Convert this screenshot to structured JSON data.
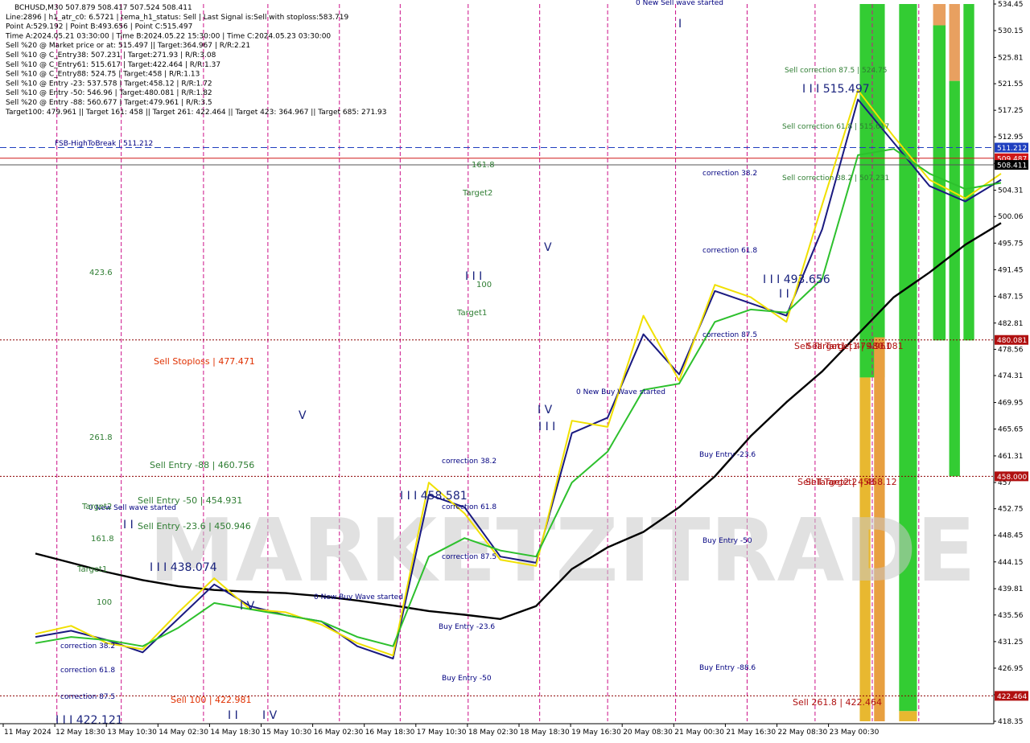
{
  "chart_data": {
    "type": "line",
    "symbol": "BCHUSD,M30",
    "info_lines": [
      "BCHUSD,M30  507.879 508.417 507.524 508.411",
      "Line:2896 | h1_atr_c0: 6.5721 | tema_h1_status: Sell | Last Signal is:Sell with stoploss:583.719",
      "Point A:529.192 | Point B:493.656 | Point C:515.497",
      "Time A:2024.05.21 03:30:00 | Time B:2024.05.22 15:30:00 | Time C:2024.05.23 03:30:00",
      "Sell %20 @ Market price or at: 515.497 || Target:364.967 | R/R:2.21",
      "Sell %10 @ C_Entry38: 507.231 | Target:271.93 | R/R:3.08",
      "Sell %10 @ C_Entry61: 515.617 | Target:422.464 | R/R:1.37",
      "Sell %10 @ C_Entry88: 524.75 | Target:458 | R/R:1.13",
      "Sell %10 @ Entry -23: 537.578 | Target:458.12 | R/R:1.72",
      "Sell %10 @ Entry -50: 546.96 | Target:480.081 | R/R:1.82",
      "Sell %20 @ Entry -88: 560.677 | Target:479.961 | R/R:3.5",
      "Target100: 479.961 || Target 161: 458 || Target 261: 422.464 || Target 423: 364.967 || Target 685: 271.93"
    ],
    "y_ticks": [
      534.45,
      530.15,
      525.81,
      521.55,
      517.25,
      512.95,
      508.65,
      504.31,
      500.06,
      495.75,
      491.45,
      487.15,
      482.81,
      478.56,
      474.31,
      469.95,
      465.65,
      461.31,
      457.0,
      452.75,
      448.45,
      444.15,
      439.81,
      435.56,
      431.25,
      426.95,
      422.65,
      418.35
    ],
    "ylim": [
      418.35,
      534.45
    ],
    "x_labels": [
      "11 May 2024",
      "12 May 18:30",
      "13 May 10:30",
      "14 May 02:30",
      "14 May 18:30",
      "15 May 10:30",
      "16 May 02:30",
      "16 May 18:30",
      "17 May 10:30",
      "18 May 02:30",
      "18 May 18:30",
      "19 May 16:30",
      "20 May 08:30",
      "21 May 00:30",
      "21 May 16:30",
      "22 May 08:30",
      "23 May 00:30"
    ],
    "price_tags": [
      {
        "value": 511.212,
        "label": "511.212",
        "color": "#1f3fbf"
      },
      {
        "value": 509.487,
        "label": "509.487",
        "color": "#d01818"
      },
      {
        "value": 508.411,
        "label": "508.411",
        "color": "#000000"
      },
      {
        "value": 480.081,
        "label": "480.081",
        "color": "#b01010"
      },
      {
        "value": 458.0,
        "label": "458.000",
        "color": "#b01010"
      },
      {
        "value": 422.464,
        "label": "422.464",
        "color": "#b01010"
      }
    ],
    "hlines": [
      {
        "value": 511.212,
        "color": "#1f3fbf",
        "style": "dash"
      },
      {
        "value": 509.487,
        "color": "#d01818",
        "style": "solid"
      },
      {
        "value": 508.411,
        "color": "#555555",
        "style": "solid"
      },
      {
        "value": 480.081,
        "color": "#8b0000",
        "style": "dot"
      },
      {
        "value": 458.0,
        "color": "#8b0000",
        "style": "dot"
      },
      {
        "value": 422.464,
        "color": "#8b0000",
        "style": "dot"
      }
    ],
    "annotations": [
      {
        "text": "FSB-HighToBreak | 511.212",
        "color": "#000080"
      },
      {
        "text": "Sell Stoploss | 477.471",
        "color": "#e03000"
      },
      {
        "text": "Sell Entry -88 | 460.756",
        "color": "#2e7d32"
      },
      {
        "text": "Sell Entry -50 | 454.931",
        "color": "#2e7d32"
      },
      {
        "text": "Sell Entry -23.6 | 450.946",
        "color": "#2e7d32"
      },
      {
        "text": "I I I 438.074",
        "color": "#1a237e"
      },
      {
        "text": "Sell 100 | 422.981",
        "color": "#e03000"
      },
      {
        "text": "I I I 422.121",
        "color": "#1a237e"
      },
      {
        "text": "0 New Sell wave started",
        "color": "#000080"
      },
      {
        "text": "0 New Buy Wave started",
        "color": "#000080"
      },
      {
        "text": "0 New Buy Wave started",
        "color": "#000080"
      },
      {
        "text": "0 New Sell wave started",
        "color": "#000080"
      },
      {
        "text": "I I I 458.581",
        "color": "#1a237e"
      },
      {
        "text": "I I I 493.656",
        "color": "#1a237e"
      },
      {
        "text": "I I I 515.497",
        "color": "#1a237e"
      },
      {
        "text": "Sell correction 87.5 | 524.75",
        "color": "#2e7d32"
      },
      {
        "text": "Sell correction 61.8 | 515.617",
        "color": "#2e7d32"
      },
      {
        "text": "Sell correction 38.2 | 507.231",
        "color": "#2e7d32"
      },
      {
        "text": "Sell Target1 | 479.961",
        "color": "#b01010"
      },
      {
        "text": "Sell Target1 | 480.081",
        "color": "#b01010"
      },
      {
        "text": "Sell Target2 | 458",
        "color": "#b01010"
      },
      {
        "text": "Sell Target2 | 458.12",
        "color": "#b01010"
      },
      {
        "text": "Sell  261.8 | 422.464",
        "color": "#b01010"
      },
      {
        "text": "correction 38.2",
        "color": "#000080"
      },
      {
        "text": "correction 61.8",
        "color": "#000080"
      },
      {
        "text": "correction 87.5",
        "color": "#000080"
      },
      {
        "text": "correction 38.2",
        "color": "#000080"
      },
      {
        "text": "correction 61.8",
        "color": "#000080"
      },
      {
        "text": "correction 87.5",
        "color": "#000080"
      },
      {
        "text": "correction 38.2",
        "color": "#000080"
      },
      {
        "text": "correction 61.8",
        "color": "#000080"
      },
      {
        "text": "correction 87.5",
        "color": "#000080"
      },
      {
        "text": "Buy Entry -23.6",
        "color": "#000080"
      },
      {
        "text": "Buy Entry -50",
        "color": "#000080"
      },
      {
        "text": "Buy Entry -23.6",
        "color": "#000080"
      },
      {
        "text": "Buy Entry -50",
        "color": "#000080"
      },
      {
        "text": "Buy Entry -88.6",
        "color": "#000080"
      },
      {
        "text": "423.6",
        "color": "#2e7d32"
      },
      {
        "text": "261.8",
        "color": "#2e7d32"
      },
      {
        "text": "161.8",
        "color": "#2e7d32"
      },
      {
        "text": "161.8",
        "color": "#2e7d32"
      },
      {
        "text": "Target2",
        "color": "#2e7d32"
      },
      {
        "text": "Target2",
        "color": "#2e7d32"
      },
      {
        "text": "Target1",
        "color": "#2e7d32"
      },
      {
        "text": "Target1",
        "color": "#2e7d32"
      },
      {
        "text": "100",
        "color": "#2e7d32"
      },
      {
        "text": "100",
        "color": "#2e7d32"
      },
      {
        "text": "V",
        "color": "#1a237e"
      },
      {
        "text": "V",
        "color": "#1a237e"
      },
      {
        "text": "I V",
        "color": "#1a237e"
      },
      {
        "text": "I V",
        "color": "#1a237e"
      },
      {
        "text": "I V",
        "color": "#1a237e"
      },
      {
        "text": "I I I",
        "color": "#1a237e"
      },
      {
        "text": "I I I",
        "color": "#1a237e"
      },
      {
        "text": "I I",
        "color": "#1a237e"
      },
      {
        "text": "I I",
        "color": "#1a237e"
      },
      {
        "text": "I I",
        "color": "#1a237e"
      },
      {
        "text": "I",
        "color": "#1a237e"
      }
    ],
    "series": [
      {
        "name": "",
        "color": "#000000",
        "x": [
          0,
          1,
          2,
          3,
          4,
          5,
          6,
          7,
          8,
          9,
          10,
          11,
          12,
          13,
          14,
          15,
          16,
          17,
          18,
          19,
          20,
          21,
          22,
          23,
          24,
          25,
          26,
          27
        ],
        "values": [
          445.5,
          444.0,
          442.5,
          441.2,
          440.2,
          439.6,
          439.3,
          439.1,
          438.6,
          437.9,
          437.1,
          436.2,
          435.6,
          434.9,
          437.0,
          443.0,
          446.5,
          449.0,
          453.0,
          458.0,
          464.5,
          470.0,
          475.0,
          481.0,
          487.0,
          491.0,
          495.5,
          499.0
        ]
      },
      {
        "name": "",
        "color": "#1a1a80",
        "x": [
          0,
          1,
          2,
          3,
          4,
          5,
          6,
          7,
          8,
          9,
          10,
          11,
          12,
          13,
          14,
          15,
          16,
          17,
          18,
          19,
          20,
          21,
          22,
          23,
          24,
          25,
          26,
          27
        ],
        "values": [
          432.0,
          433.0,
          431.5,
          429.5,
          435.0,
          440.5,
          437.0,
          435.5,
          434.5,
          430.5,
          428.5,
          455.0,
          453.0,
          445.0,
          444.0,
          465.0,
          467.5,
          481.0,
          474.5,
          488.0,
          486.0,
          484.0,
          498.0,
          519.0,
          512.0,
          505.0,
          502.5,
          506.0
        ]
      },
      {
        "name": "",
        "color": "#f0e000",
        "x": [
          0,
          1,
          2,
          3,
          4,
          5,
          6,
          7,
          8,
          9,
          10,
          11,
          12,
          13,
          14,
          15,
          16,
          17,
          18,
          19,
          20,
          21,
          22,
          23,
          24,
          25,
          26,
          27
        ],
        "values": [
          432.5,
          433.8,
          431.0,
          430.0,
          436.0,
          441.5,
          436.5,
          436.0,
          434.0,
          431.0,
          429.0,
          457.0,
          452.0,
          444.5,
          443.5,
          467.0,
          466.0,
          484.0,
          473.5,
          489.0,
          487.0,
          483.0,
          502.0,
          520.5,
          513.0,
          506.0,
          503.0,
          507.0
        ]
      },
      {
        "name": "",
        "color": "#2dc02d",
        "x": [
          0,
          1,
          2,
          3,
          4,
          5,
          6,
          7,
          8,
          9,
          10,
          11,
          12,
          13,
          14,
          15,
          16,
          17,
          18,
          19,
          20,
          21,
          22,
          23,
          24,
          25,
          26,
          27
        ],
        "values": [
          431.0,
          432.0,
          431.5,
          430.5,
          433.5,
          437.5,
          436.5,
          435.5,
          434.5,
          432.0,
          430.5,
          445.0,
          448.0,
          446.0,
          445.0,
          457.0,
          462.0,
          472.0,
          473.0,
          483.0,
          485.0,
          484.5,
          490.0,
          510.0,
          511.0,
          507.0,
          504.5,
          505.5
        ]
      }
    ],
    "zones": [
      {
        "color": "#33cc33",
        "x0": 23.05,
        "x1": 23.75,
        "y0": 474.0,
        "y1": 534.45
      },
      {
        "color": "#33cc33",
        "x0": 24.15,
        "x1": 24.65,
        "y0": 420.0,
        "y1": 534.45
      },
      {
        "color": "#e8b830",
        "x0": 23.05,
        "x1": 23.35,
        "y0": 418.35,
        "y1": 474.0
      },
      {
        "color": "#e8a040",
        "x0": 23.45,
        "x1": 23.75,
        "y0": 418.35,
        "y1": 480.5
      },
      {
        "color": "#e8b830",
        "x0": 24.15,
        "x1": 24.65,
        "y0": 418.35,
        "y1": 420.0
      },
      {
        "color": "#33cc33",
        "x0": 25.1,
        "x1": 25.45,
        "y0": 480.0,
        "y1": 531.0
      },
      {
        "color": "#e8a060",
        "x0": 25.1,
        "x1": 25.45,
        "y0": 531.0,
        "y1": 534.45
      },
      {
        "color": "#e8a060",
        "x0": 25.55,
        "x1": 25.85,
        "y0": 522.0,
        "y1": 534.45
      },
      {
        "color": "#33cc33",
        "x0": 25.55,
        "x1": 25.85,
        "y0": 458.0,
        "y1": 522.0
      },
      {
        "color": "#33cc33",
        "x0": 25.95,
        "x1": 26.25,
        "y0": 480.0,
        "y1": 534.45
      }
    ],
    "vlines": [
      0.6,
      2.4,
      4.7,
      6.5,
      8.5,
      10.2,
      12.1,
      14.1,
      16.0,
      17.9,
      19.9,
      21.8,
      23.4,
      24.7
    ],
    "watermark": "MARKETZITRADE"
  }
}
